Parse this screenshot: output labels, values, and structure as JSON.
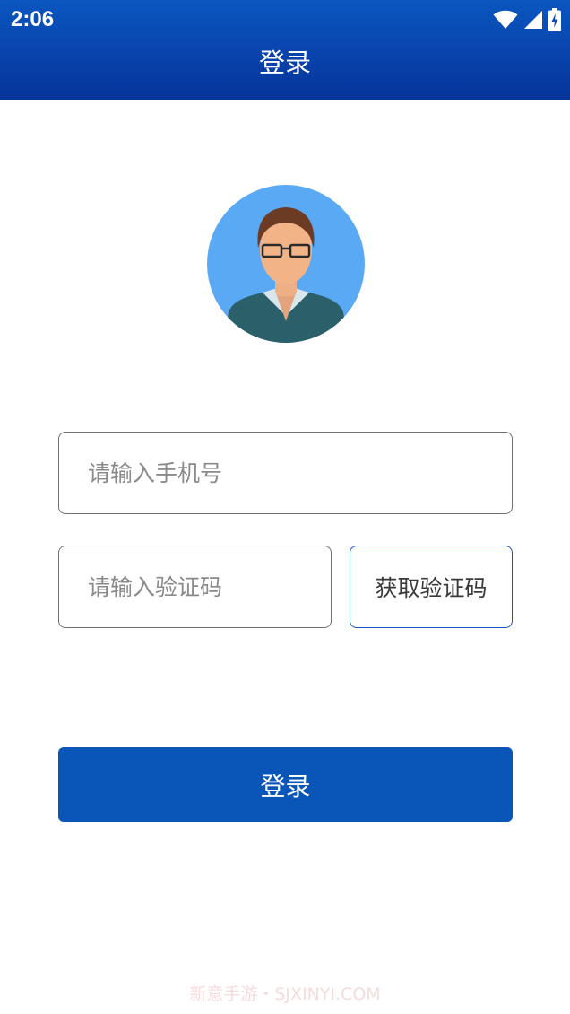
{
  "status_bar": {
    "time": "2:06",
    "icons": [
      "wifi-icon",
      "cellular-signal-icon",
      "battery-charging-icon"
    ]
  },
  "header": {
    "title": "登录",
    "background_color": "#0a47b0"
  },
  "avatar": {
    "icon": "user-avatar-icon"
  },
  "form": {
    "phone_placeholder": "请输入手机号",
    "code_placeholder": "请输入验证码",
    "get_code_label": "获取验证码"
  },
  "login_button": {
    "label": "登录",
    "color": "#0a56b8"
  },
  "watermark": "新意手游・SJXINYI.COM"
}
